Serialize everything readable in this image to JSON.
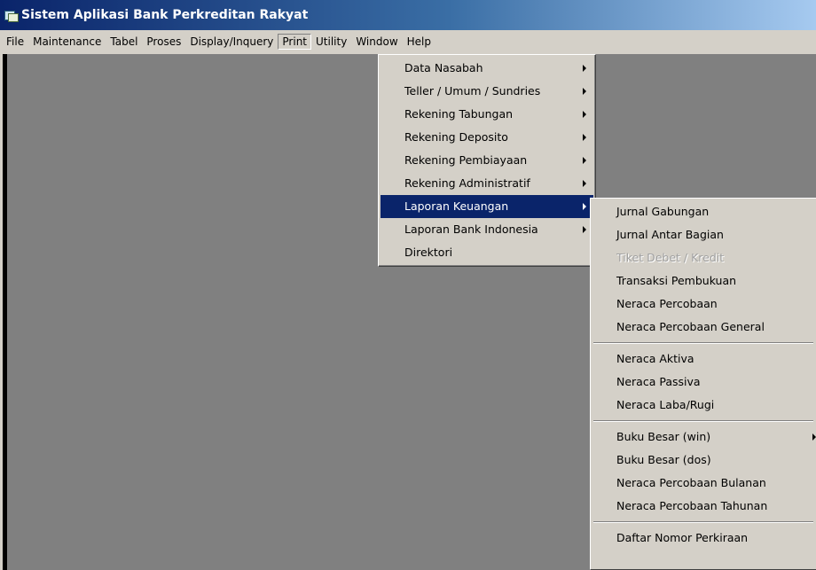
{
  "window": {
    "title": "Sistem Aplikasi Bank Perkreditan Rakyat"
  },
  "menubar": {
    "items": [
      "File",
      "Maintenance",
      "Tabel",
      "Proses",
      "Display/Inquery",
      "Print",
      "Utility",
      "Window",
      "Help"
    ],
    "open_item": "Print"
  },
  "print_menu": {
    "items": [
      {
        "label": "Data Nasabah",
        "submenu": true
      },
      {
        "label": "Teller / Umum / Sundries",
        "submenu": true
      },
      {
        "label": "Rekening Tabungan",
        "submenu": true
      },
      {
        "label": "Rekening Deposito",
        "submenu": true
      },
      {
        "label": "Rekening Pembiayaan",
        "submenu": true
      },
      {
        "label": "Rekening Administratif",
        "submenu": true
      },
      {
        "label": "Laporan Keuangan",
        "submenu": true,
        "selected": true
      },
      {
        "label": "Laporan Bank Indonesia",
        "submenu": true
      },
      {
        "label": "Direktori",
        "submenu": false
      }
    ]
  },
  "laporan_keuangan_menu": {
    "groups": [
      [
        {
          "label": "Jurnal Gabungan"
        },
        {
          "label": "Jurnal Antar Bagian"
        },
        {
          "label": "Tiket Debet / Kredit",
          "disabled": true
        },
        {
          "label": "Transaksi Pembukuan"
        },
        {
          "label": "Neraca Percobaan"
        },
        {
          "label": "Neraca Percobaan General"
        }
      ],
      [
        {
          "label": "Neraca Aktiva"
        },
        {
          "label": "Neraca Passiva"
        },
        {
          "label": "Neraca Laba/Rugi"
        }
      ],
      [
        {
          "label": "Buku Besar (win)",
          "submenu": true
        },
        {
          "label": "Buku Besar (dos)"
        },
        {
          "label": "Neraca Percobaan Bulanan"
        },
        {
          "label": "Neraca Percobaan Tahunan"
        }
      ],
      [
        {
          "label": "Daftar Nomor Perkiraan"
        }
      ]
    ]
  },
  "colors": {
    "titlebar_start": "#0a246a",
    "titlebar_end": "#a6caf0",
    "menu_face": "#d4d0c8",
    "workspace": "#808080",
    "highlight": "#0a246a"
  }
}
